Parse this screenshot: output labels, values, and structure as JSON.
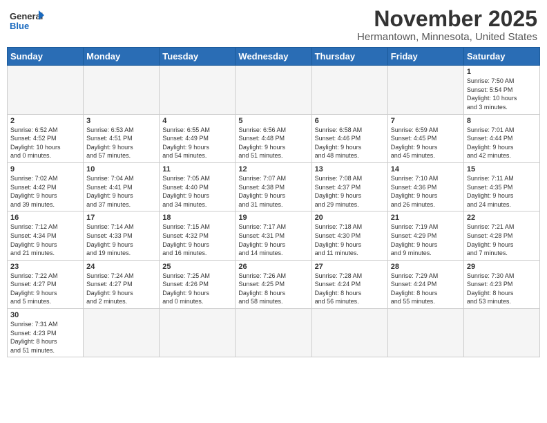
{
  "header": {
    "logo_text_general": "General",
    "logo_text_blue": "Blue",
    "month": "November 2025",
    "location": "Hermantown, Minnesota, United States"
  },
  "days_of_week": [
    "Sunday",
    "Monday",
    "Tuesday",
    "Wednesday",
    "Thursday",
    "Friday",
    "Saturday"
  ],
  "weeks": [
    [
      {
        "day": "",
        "info": ""
      },
      {
        "day": "",
        "info": ""
      },
      {
        "day": "",
        "info": ""
      },
      {
        "day": "",
        "info": ""
      },
      {
        "day": "",
        "info": ""
      },
      {
        "day": "",
        "info": ""
      },
      {
        "day": "1",
        "info": "Sunrise: 7:50 AM\nSunset: 5:54 PM\nDaylight: 10 hours\nand 3 minutes."
      }
    ],
    [
      {
        "day": "2",
        "info": "Sunrise: 6:52 AM\nSunset: 4:52 PM\nDaylight: 10 hours\nand 0 minutes."
      },
      {
        "day": "3",
        "info": "Sunrise: 6:53 AM\nSunset: 4:51 PM\nDaylight: 9 hours\nand 57 minutes."
      },
      {
        "day": "4",
        "info": "Sunrise: 6:55 AM\nSunset: 4:49 PM\nDaylight: 9 hours\nand 54 minutes."
      },
      {
        "day": "5",
        "info": "Sunrise: 6:56 AM\nSunset: 4:48 PM\nDaylight: 9 hours\nand 51 minutes."
      },
      {
        "day": "6",
        "info": "Sunrise: 6:58 AM\nSunset: 4:46 PM\nDaylight: 9 hours\nand 48 minutes."
      },
      {
        "day": "7",
        "info": "Sunrise: 6:59 AM\nSunset: 4:45 PM\nDaylight: 9 hours\nand 45 minutes."
      },
      {
        "day": "8",
        "info": "Sunrise: 7:01 AM\nSunset: 4:44 PM\nDaylight: 9 hours\nand 42 minutes."
      }
    ],
    [
      {
        "day": "9",
        "info": "Sunrise: 7:02 AM\nSunset: 4:42 PM\nDaylight: 9 hours\nand 39 minutes."
      },
      {
        "day": "10",
        "info": "Sunrise: 7:04 AM\nSunset: 4:41 PM\nDaylight: 9 hours\nand 37 minutes."
      },
      {
        "day": "11",
        "info": "Sunrise: 7:05 AM\nSunset: 4:40 PM\nDaylight: 9 hours\nand 34 minutes."
      },
      {
        "day": "12",
        "info": "Sunrise: 7:07 AM\nSunset: 4:38 PM\nDaylight: 9 hours\nand 31 minutes."
      },
      {
        "day": "13",
        "info": "Sunrise: 7:08 AM\nSunset: 4:37 PM\nDaylight: 9 hours\nand 29 minutes."
      },
      {
        "day": "14",
        "info": "Sunrise: 7:10 AM\nSunset: 4:36 PM\nDaylight: 9 hours\nand 26 minutes."
      },
      {
        "day": "15",
        "info": "Sunrise: 7:11 AM\nSunset: 4:35 PM\nDaylight: 9 hours\nand 24 minutes."
      }
    ],
    [
      {
        "day": "16",
        "info": "Sunrise: 7:12 AM\nSunset: 4:34 PM\nDaylight: 9 hours\nand 21 minutes."
      },
      {
        "day": "17",
        "info": "Sunrise: 7:14 AM\nSunset: 4:33 PM\nDaylight: 9 hours\nand 19 minutes."
      },
      {
        "day": "18",
        "info": "Sunrise: 7:15 AM\nSunset: 4:32 PM\nDaylight: 9 hours\nand 16 minutes."
      },
      {
        "day": "19",
        "info": "Sunrise: 7:17 AM\nSunset: 4:31 PM\nDaylight: 9 hours\nand 14 minutes."
      },
      {
        "day": "20",
        "info": "Sunrise: 7:18 AM\nSunset: 4:30 PM\nDaylight: 9 hours\nand 11 minutes."
      },
      {
        "day": "21",
        "info": "Sunrise: 7:19 AM\nSunset: 4:29 PM\nDaylight: 9 hours\nand 9 minutes."
      },
      {
        "day": "22",
        "info": "Sunrise: 7:21 AM\nSunset: 4:28 PM\nDaylight: 9 hours\nand 7 minutes."
      }
    ],
    [
      {
        "day": "23",
        "info": "Sunrise: 7:22 AM\nSunset: 4:27 PM\nDaylight: 9 hours\nand 5 minutes."
      },
      {
        "day": "24",
        "info": "Sunrise: 7:24 AM\nSunset: 4:27 PM\nDaylight: 9 hours\nand 2 minutes."
      },
      {
        "day": "25",
        "info": "Sunrise: 7:25 AM\nSunset: 4:26 PM\nDaylight: 9 hours\nand 0 minutes."
      },
      {
        "day": "26",
        "info": "Sunrise: 7:26 AM\nSunset: 4:25 PM\nDaylight: 8 hours\nand 58 minutes."
      },
      {
        "day": "27",
        "info": "Sunrise: 7:28 AM\nSunset: 4:24 PM\nDaylight: 8 hours\nand 56 minutes."
      },
      {
        "day": "28",
        "info": "Sunrise: 7:29 AM\nSunset: 4:24 PM\nDaylight: 8 hours\nand 55 minutes."
      },
      {
        "day": "29",
        "info": "Sunrise: 7:30 AM\nSunset: 4:23 PM\nDaylight: 8 hours\nand 53 minutes."
      }
    ],
    [
      {
        "day": "30",
        "info": "Sunrise: 7:31 AM\nSunset: 4:23 PM\nDaylight: 8 hours\nand 51 minutes."
      },
      {
        "day": "",
        "info": ""
      },
      {
        "day": "",
        "info": ""
      },
      {
        "day": "",
        "info": ""
      },
      {
        "day": "",
        "info": ""
      },
      {
        "day": "",
        "info": ""
      },
      {
        "day": "",
        "info": ""
      }
    ]
  ]
}
